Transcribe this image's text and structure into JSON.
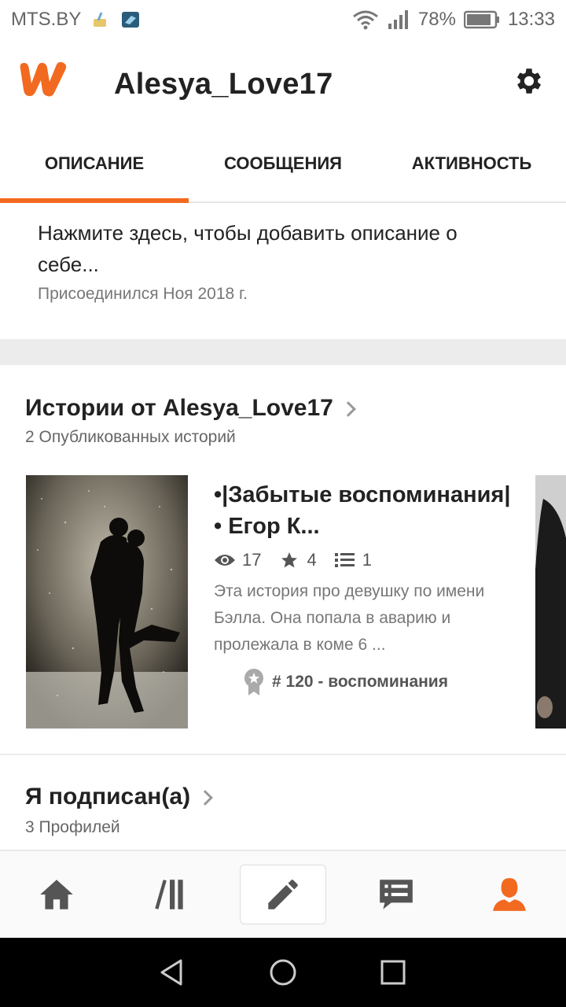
{
  "status_bar": {
    "carrier": "MTS.BY",
    "battery": "78%",
    "time": "13:33"
  },
  "header": {
    "username": "Alesya_Love17",
    "brand_color": "#f26a20"
  },
  "tabs": [
    {
      "label": "ОПИСАНИЕ",
      "active": true
    },
    {
      "label": "СООБЩЕНИЯ",
      "active": false
    },
    {
      "label": "АКТИВНОСТЬ",
      "active": false
    }
  ],
  "profile": {
    "description_prompt": "Нажмите здесь, чтобы добавить описание о себе...",
    "joined": "Присоединился Ноя 2018 г."
  },
  "stories_section": {
    "title": "Истории от Alesya_Love17",
    "subtitle": "2 Опубликованных историй",
    "story": {
      "title": "•|Забытые воспоминания|• Егор К...",
      "reads": "17",
      "votes": "4",
      "parts": "1",
      "description": "Эта история про девушку по имени Бэлла. Она попала в аварию и пролежала в коме 6 ...",
      "rank": "# 120 - воспоминания"
    }
  },
  "following_section": {
    "title": "Я подписан(а)",
    "subtitle": "3 Профилей"
  },
  "bottom_nav": {
    "items": [
      "home-icon",
      "library-icon",
      "write-icon",
      "messages-icon",
      "profile-icon"
    ],
    "active_color": "#f26a20",
    "inactive_color": "#555555"
  }
}
